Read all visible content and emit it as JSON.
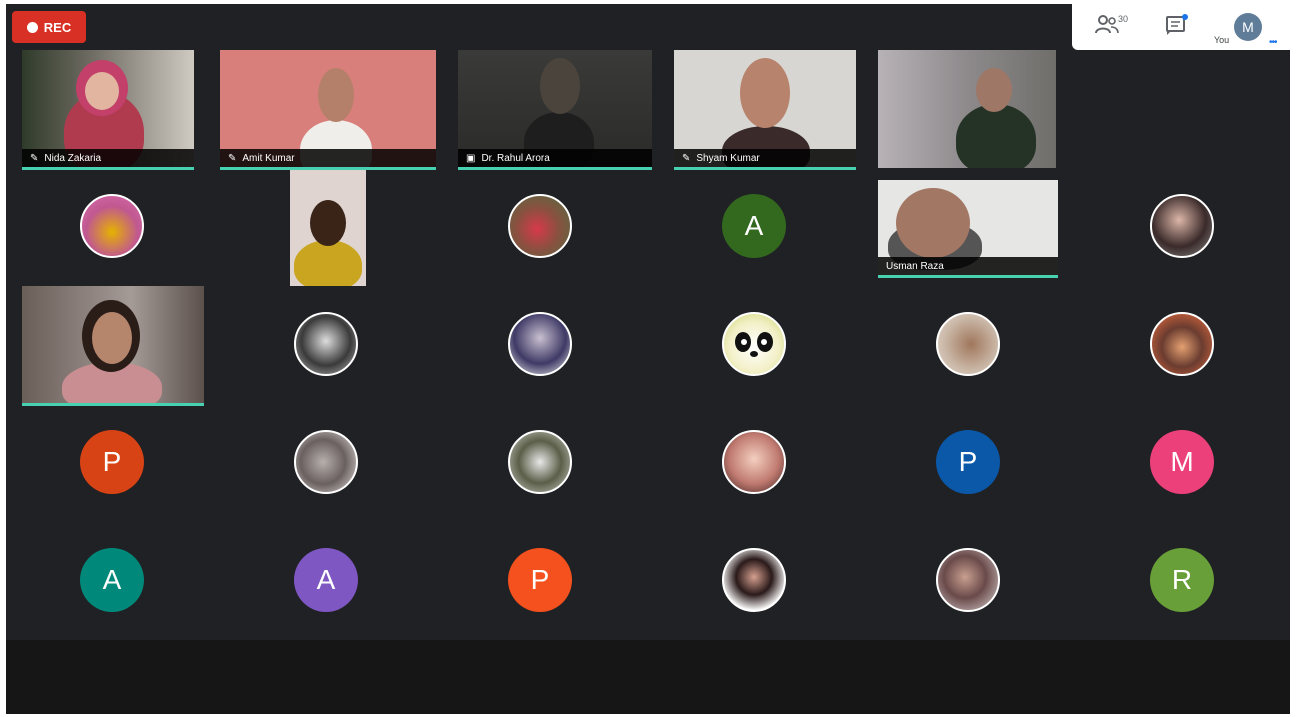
{
  "meeting": {
    "rec_label": "REC",
    "people_count": "30",
    "you_label": "You",
    "self_initial": "M"
  },
  "video_tiles": [
    {
      "id": "t1",
      "name": "Nida Zakaria",
      "icon": "mic-off-icon"
    },
    {
      "id": "t2",
      "name": "Amit Kumar",
      "icon": "mic-off-icon"
    },
    {
      "id": "t3",
      "name": "Dr. Rahul Arora",
      "icon": "present-icon"
    },
    {
      "id": "t4",
      "name": "Shyam Kumar",
      "icon": "mic-off-icon"
    },
    {
      "id": "t5",
      "name": "",
      "icon": ""
    },
    {
      "id": "t6",
      "name": "",
      "icon": ""
    },
    {
      "id": "t7",
      "name": "Usman Raza",
      "icon": ""
    },
    {
      "id": "t8",
      "name": "",
      "icon": ""
    }
  ],
  "avatars": [
    {
      "initial": "",
      "color": "#c0c0c0",
      "kind": "photo"
    },
    {
      "initial": "",
      "color": "#c0c0c0",
      "kind": "photo"
    },
    {
      "initial": "A",
      "color": "#33691e",
      "kind": "letter"
    },
    {
      "initial": "",
      "color": "#c0c0c0",
      "kind": "photo"
    },
    {
      "initial": "",
      "color": "#c0c0c0",
      "kind": "photo"
    },
    {
      "initial": "",
      "color": "#c0c0c0",
      "kind": "photo"
    },
    {
      "initial": "",
      "color": "#e0e0b0",
      "kind": "panda"
    },
    {
      "initial": "",
      "color": "#c0c0c0",
      "kind": "photo"
    },
    {
      "initial": "",
      "color": "#c0c0c0",
      "kind": "photo"
    },
    {
      "initial": "P",
      "color": "#d84315",
      "kind": "letter"
    },
    {
      "initial": "",
      "color": "#c0c0c0",
      "kind": "photo"
    },
    {
      "initial": "",
      "color": "#c0c0c0",
      "kind": "photo"
    },
    {
      "initial": "",
      "color": "#c0c0c0",
      "kind": "photo"
    },
    {
      "initial": "P",
      "color": "#0b57a8",
      "kind": "letter"
    },
    {
      "initial": "M",
      "color": "#ec407a",
      "kind": "letter"
    },
    {
      "initial": "A",
      "color": "#00897b",
      "kind": "letter"
    },
    {
      "initial": "A",
      "color": "#7e57c2",
      "kind": "letter"
    },
    {
      "initial": "P",
      "color": "#f4511e",
      "kind": "letter"
    },
    {
      "initial": "",
      "color": "#c0c0c0",
      "kind": "photo"
    },
    {
      "initial": "",
      "color": "#c0c0c0",
      "kind": "photo"
    },
    {
      "initial": "R",
      "color": "#689f38",
      "kind": "letter"
    }
  ]
}
